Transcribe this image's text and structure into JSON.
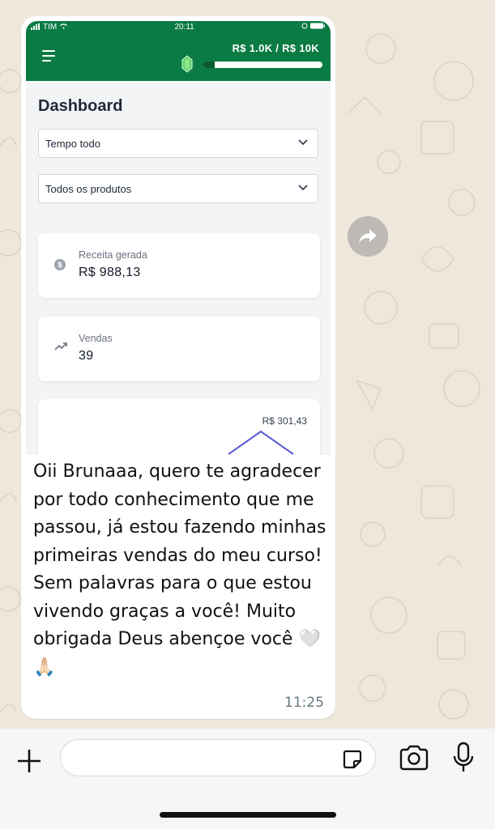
{
  "statusbar": {
    "carrier": "TIM",
    "time": "20:11"
  },
  "app": {
    "goal_text": "R$ 1.0K / R$ 10K",
    "goal_progress_fraction": 0.1,
    "dashboard_title": "Dashboard",
    "period_select": "Tempo todo",
    "product_select": "Todos os produtos",
    "revenue": {
      "label": "Receita gerada",
      "value": "R$ 988,13"
    },
    "sales": {
      "label": "Vendas",
      "value": "39"
    },
    "chart_peak_label": "R$ 301,43"
  },
  "message": {
    "text": "Oii Brunaaa, quero te agradecer por todo conhecimento que me passou, já estou fazendo minhas primeiras vendas do meu curso! Sem palavras para o que estou vivendo graças a você! Muito obrigada Deus abençoe você 🤍🙏🏻",
    "time": "11:25"
  },
  "colors": {
    "accent": "#0b7b44",
    "chart_line": "#5b5bd6",
    "wallpaper": "#efe7dc"
  },
  "icons": [
    "menu-icon",
    "gem-icon",
    "chevron-down-icon",
    "dollar-icon",
    "trending-up-icon",
    "forward-icon",
    "plus-icon",
    "sticker-icon",
    "camera-icon",
    "mic-icon"
  ]
}
